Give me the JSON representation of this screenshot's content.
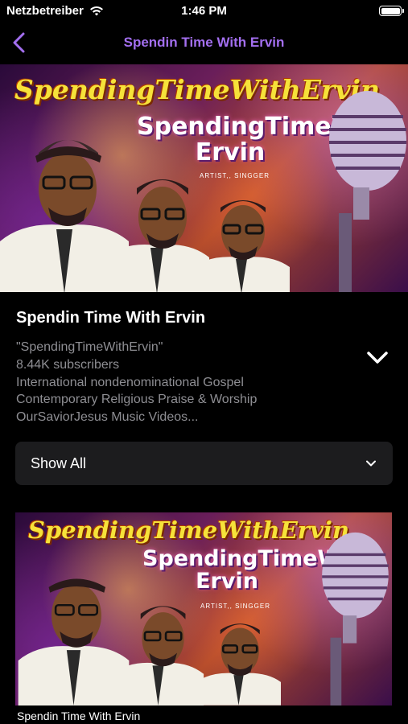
{
  "status_bar": {
    "carrier": "Netzbetreiber",
    "time": "1:46 PM"
  },
  "nav": {
    "title": "Spendin Time With Ervin",
    "accent_color": "#a36ff0"
  },
  "banner": {
    "headline": "SpendingTimeWithErvin",
    "subtitle_line1": "SpendingTimeWih",
    "subtitle_line2": "Ervin",
    "tagline": "ARTIST,, SINGGER"
  },
  "channel": {
    "title": "Spendin Time With Ervin",
    "description_lines": [
      "\"SpendingTimeWithErvin\"",
      "8.44K subscribers",
      "International nondenominational Gospel",
      "Contemporary Religious Praise & Worship",
      "OurSaviorJesus Music Videos..."
    ]
  },
  "show_all": {
    "label": "Show All"
  },
  "videos": [
    {
      "title": "Spendin Time With Ervin",
      "thumb_headline": "SpendingTimeWithErvin",
      "thumb_subtitle_line1": "SpendingTimeWih",
      "thumb_subtitle_line2": "Ervin",
      "thumb_tagline": "ARTIST,, SINGGER"
    }
  ],
  "icons": {
    "back": "chevron-left-icon",
    "expand": "chevron-down-icon",
    "show_all_chevron": "chevron-down-icon",
    "wifi": "wifi-icon",
    "battery": "battery-icon"
  }
}
